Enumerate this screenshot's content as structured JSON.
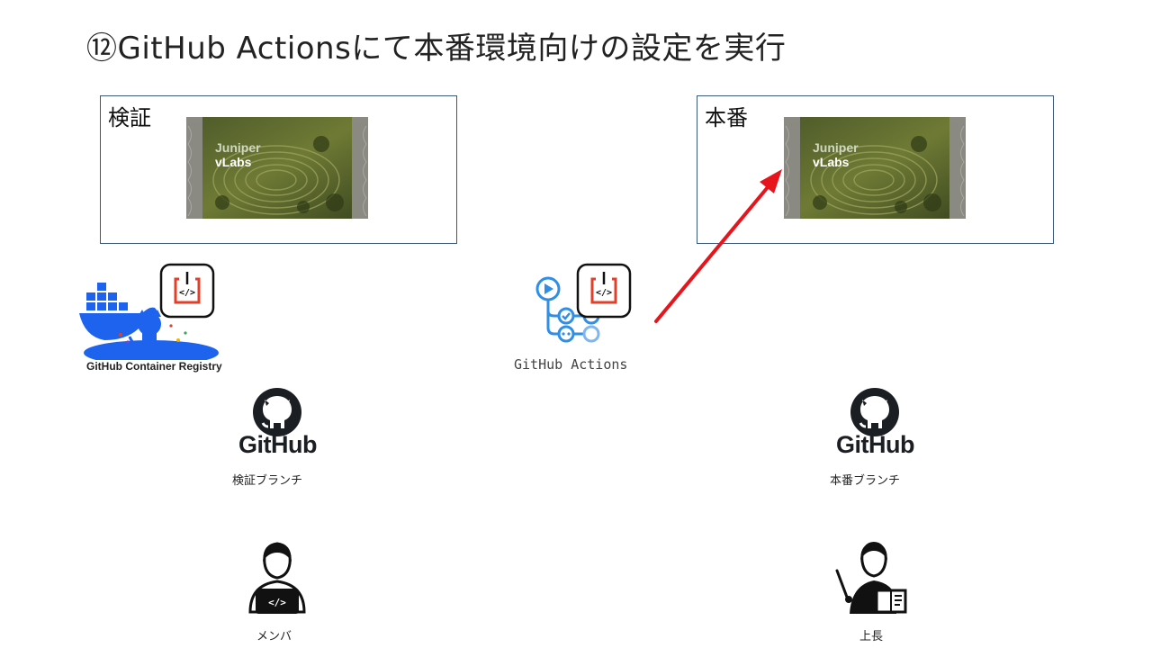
{
  "slide": {
    "title": "⑫GitHub Actionsにて本番環境向けの設定を実行"
  },
  "environments": {
    "staging": {
      "label": "検証",
      "logo_line1": "Juniper",
      "logo_line2": "vLabs"
    },
    "production": {
      "label": "本番",
      "logo_line1": "Juniper",
      "logo_line2": "vLabs"
    }
  },
  "registry": {
    "label": "GitHub Container Registry"
  },
  "actions": {
    "label": "GitHub Actions"
  },
  "branches": {
    "staging": {
      "logo_text": "GitHub",
      "label": "検証ブランチ"
    },
    "production": {
      "logo_text": "GitHub",
      "label": "本番ブランチ"
    }
  },
  "people": {
    "member": {
      "label": "メンバ"
    },
    "manager": {
      "label": "上長"
    }
  },
  "colors": {
    "arrow": "#e8141c",
    "box_border": "#3b5a7a",
    "docker_blue": "#1d63ed",
    "actions_blue": "#2f8ee6",
    "code_red": "#e0402a"
  },
  "icons": {
    "docker": "docker-whale-icon",
    "code_box": "code-box-icon",
    "actions": "github-actions-workflow-icon",
    "github": "github-octocat-icon",
    "member": "developer-laptop-icon",
    "manager": "presenter-icon"
  }
}
